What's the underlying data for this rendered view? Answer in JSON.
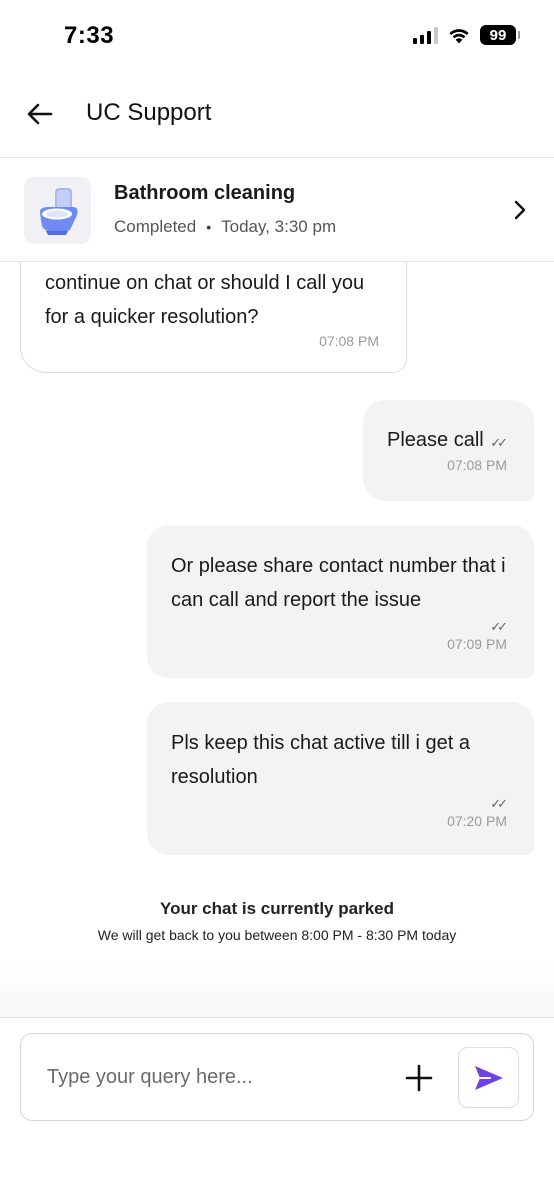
{
  "status_bar": {
    "time": "7:33",
    "battery": "99"
  },
  "header": {
    "title": "UC Support",
    "back_icon": "arrow-left-icon"
  },
  "booking": {
    "title": "Bathroom cleaning",
    "status": "Completed",
    "datetime": "Today, 3:30 pm",
    "thumbnail_icon": "toilet-icon",
    "chevron_icon": "chevron-right-icon"
  },
  "messages": [
    {
      "direction": "incoming",
      "text": "continue on chat or should I call you for a quicker resolution?",
      "time": "07:08 PM"
    },
    {
      "direction": "outgoing",
      "text": "Please call",
      "time": "07:08 PM",
      "ticks": "✓✓"
    },
    {
      "direction": "outgoing",
      "text": "Or please share contact number that i can call and report the issue",
      "time": "07:09 PM",
      "ticks": "✓✓"
    },
    {
      "direction": "outgoing",
      "text": "Pls keep this chat active till i get a resolution",
      "time": "07:20 PM",
      "ticks": "✓✓"
    }
  ],
  "parked_notice": {
    "title": "Your chat is currently parked",
    "subtitle": "We will get back to you between 8:00 PM - 8:30 PM today"
  },
  "composer": {
    "placeholder": "Type your query here...",
    "value": "",
    "add_icon": "plus-icon",
    "send_icon": "send-icon",
    "send_color": "#6e42e5"
  }
}
